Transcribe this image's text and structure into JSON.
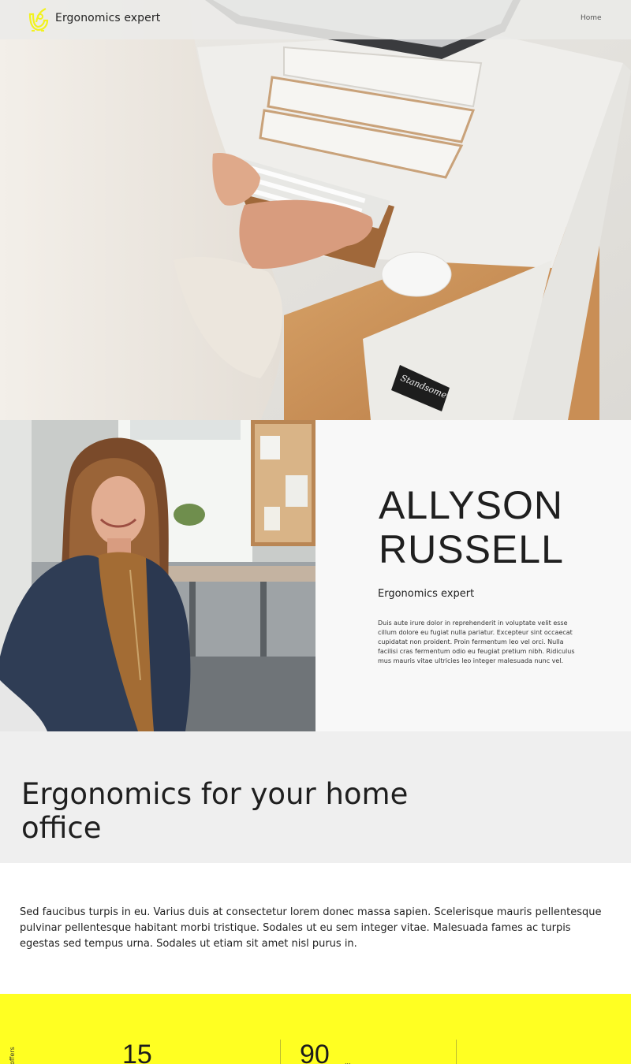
{
  "header": {
    "site_title": "Ergonomics expert",
    "nav": [
      {
        "label": "Home"
      }
    ]
  },
  "profile": {
    "name": "ALLYSON RUSSELL",
    "role": "Ergonomics expert",
    "bio": "Duis aute irure dolor in reprehenderit in voluptate velit esse cillum dolore eu fugiat nulla pariatur. Excepteur sint occaecat cupidatat non proident. Proin fermentum leo vel orci. Nulla facilisi cras fermentum odio eu feugiat pretium nibh. Ridiculus mus mauris vitae ultricies leo integer malesuada nunc vel."
  },
  "section": {
    "title": "Ergonomics for your home office"
  },
  "body_text": "Sed faucibus turpis in eu. Varius duis at consectetur lorem donec massa sapien. Scelerisque mauris pellentesque pulvinar pellentesque habitant morbi tristique. Sodales ut eu sem integer vitae. Malesuada fames ac turpis egestas sed tempus urna. Sodales ut etiam sit amet nisl purus in.",
  "stats": {
    "vertical_label": "offers",
    "items": [
      {
        "value": "15",
        "unit": ""
      },
      {
        "value": "90",
        "unit": "..."
      }
    ]
  },
  "colors": {
    "accent_yellow": "#ffff22",
    "header_bg": "#ebebe8",
    "section_gray": "#efefef"
  },
  "hero_logo_text": "Standsome"
}
